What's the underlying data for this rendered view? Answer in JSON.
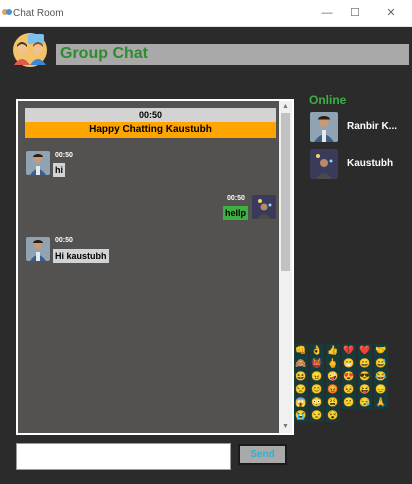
{
  "window": {
    "title": "Chat Room",
    "minimize": "—",
    "maximize": "☐",
    "close": "✕"
  },
  "header": {
    "title": "Group Chat"
  },
  "chat": {
    "time_banner": "00:50",
    "welcome": "Happy Chatting Kaustubh",
    "messages": [
      {
        "side": "left",
        "time": "00:50",
        "text": "hi"
      },
      {
        "side": "right",
        "time": "00:50",
        "text": "hellp"
      },
      {
        "side": "left",
        "time": "00:50",
        "text": "Hi kaustubh"
      }
    ]
  },
  "scrollbar": {
    "up": "▲",
    "down": "▼"
  },
  "online": {
    "label": "Online",
    "users": [
      {
        "name": "Ranbir K..."
      },
      {
        "name": "Kaustubh"
      }
    ]
  },
  "emojis": [
    "👊",
    "👌",
    "👍",
    "💔",
    "❤️",
    "🤝",
    "🙈",
    "👹",
    "🖕",
    "😁",
    "😄",
    "😅",
    "😆",
    "😠",
    "🤪",
    "😍",
    "😎",
    "😂",
    "😒",
    "😊",
    "😡",
    "😣",
    "😝",
    "😞",
    "😱",
    "😳",
    "😩",
    "😕",
    "😪",
    "🙏",
    "😭",
    "😒",
    "😵"
  ],
  "composer": {
    "input_value": "",
    "input_placeholder": "",
    "send_label": "Send"
  },
  "colors": {
    "background": "#2b2b2b",
    "header_bar": "#a9a9a9",
    "header_text": "#2e8b2e",
    "chat_background": "#545250",
    "welcome_banner": "#ffa500",
    "sent_bubble": "#3cb043",
    "received_bubble": "#d3d3d3",
    "online_label": "#3cb043",
    "send_text": "#2bb3d6"
  }
}
